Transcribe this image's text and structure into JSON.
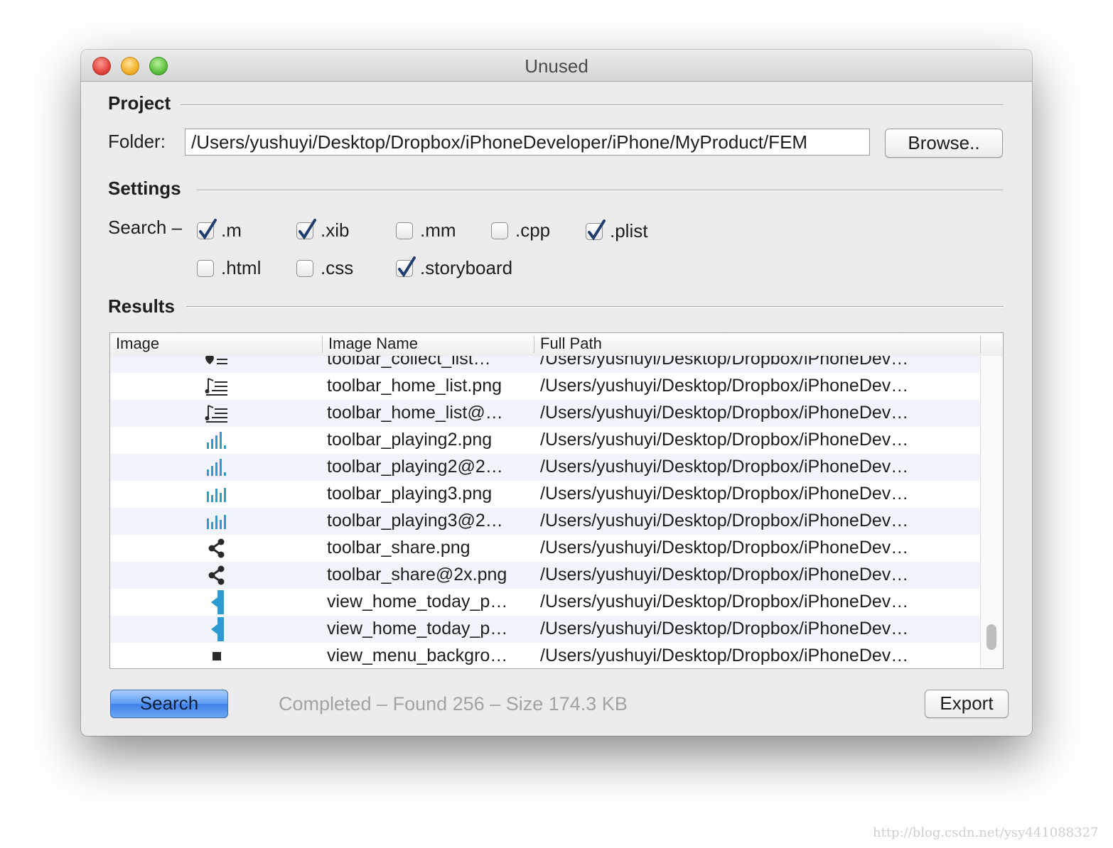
{
  "window": {
    "title": "Unused"
  },
  "project": {
    "section_label": "Project",
    "folder_label": "Folder:",
    "folder_value": "/Users/yushuyi/Desktop/Dropbox/iPhoneDeveloper/iPhone/MyProduct/FEM",
    "browse_label": "Browse.."
  },
  "settings": {
    "section_label": "Settings",
    "search_label": "Search –",
    "extensions": [
      {
        "label": ".m",
        "checked": true
      },
      {
        "label": ".xib",
        "checked": true
      },
      {
        "label": ".mm",
        "checked": false
      },
      {
        "label": ".cpp",
        "checked": false
      },
      {
        "label": ".plist",
        "checked": true
      },
      {
        "label": ".html",
        "checked": false
      },
      {
        "label": ".css",
        "checked": false
      },
      {
        "label": ".storyboard",
        "checked": true
      }
    ]
  },
  "results": {
    "section_label": "Results",
    "columns": [
      "Image",
      "Image Name",
      "Full Path"
    ],
    "rows": [
      {
        "icon": "heart-list-icon",
        "name": "toolbar_collect_list…",
        "path": "/Users/yushuyi/Desktop/Dropbox/iPhoneDev…"
      },
      {
        "icon": "music-list-icon",
        "name": "toolbar_home_list.png",
        "path": "/Users/yushuyi/Desktop/Dropbox/iPhoneDev…"
      },
      {
        "icon": "music-list-icon",
        "name": "toolbar_home_list@…",
        "path": "/Users/yushuyi/Desktop/Dropbox/iPhoneDev…"
      },
      {
        "icon": "equalizer-icon",
        "name": "toolbar_playing2.png",
        "path": "/Users/yushuyi/Desktop/Dropbox/iPhoneDev…"
      },
      {
        "icon": "equalizer-icon",
        "name": "toolbar_playing2@2…",
        "path": "/Users/yushuyi/Desktop/Dropbox/iPhoneDev…"
      },
      {
        "icon": "equalizer-alt-icon",
        "name": "toolbar_playing3.png",
        "path": "/Users/yushuyi/Desktop/Dropbox/iPhoneDev…"
      },
      {
        "icon": "equalizer-alt-icon",
        "name": "toolbar_playing3@2…",
        "path": "/Users/yushuyi/Desktop/Dropbox/iPhoneDev…"
      },
      {
        "icon": "share-icon",
        "name": "toolbar_share.png",
        "path": "/Users/yushuyi/Desktop/Dropbox/iPhoneDev…"
      },
      {
        "icon": "share-icon",
        "name": "toolbar_share@2x.png",
        "path": "/Users/yushuyi/Desktop/Dropbox/iPhoneDev…"
      },
      {
        "icon": "blue-tab-icon",
        "name": "view_home_today_p…",
        "path": "/Users/yushuyi/Desktop/Dropbox/iPhoneDev…"
      },
      {
        "icon": "blue-tab-icon",
        "name": "view_home_today_p…",
        "path": "/Users/yushuyi/Desktop/Dropbox/iPhoneDev…"
      },
      {
        "icon": "black-square-icon",
        "name": "view_menu_backgro…",
        "path": "/Users/yushuyi/Desktop/Dropbox/iPhoneDev…"
      }
    ]
  },
  "footer": {
    "search_label": "Search",
    "status": "Completed – Found 256 – Size 174.3 KB",
    "export_label": "Export"
  },
  "watermark": "http://blog.csdn.net/ysy441088327",
  "colors": {
    "accent_blue": "#3f82ea",
    "icon_blue": "#2b9bd0",
    "status_gray": "#a3a3a3"
  }
}
